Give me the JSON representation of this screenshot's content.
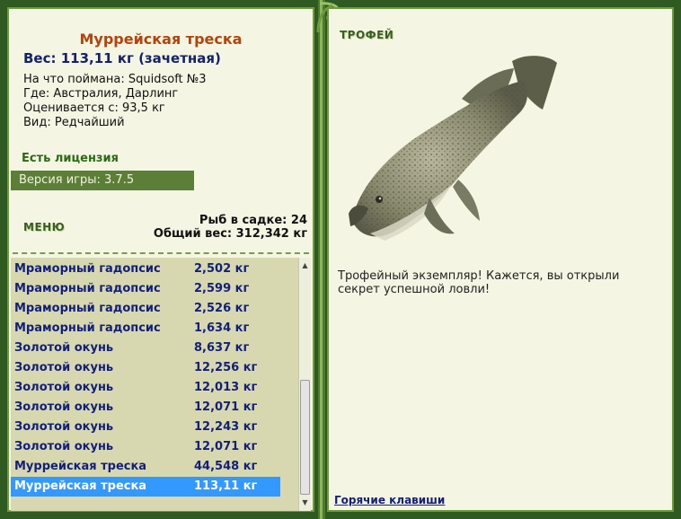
{
  "fish": {
    "title": "Муррейская треска",
    "weight": "Вес: 113,11 кг (зачетная)",
    "bait": "На что поймана: Squidsoft №3",
    "location": "Где: Австралия, Дарлинг",
    "scored_from": "Оценивается с: 93,5 кг",
    "rarity": "Вид: Редчайший"
  },
  "license": "Есть лицензия",
  "version": "Версия игры: 3.7.5",
  "menu_label": "МЕНЮ",
  "keepnet": {
    "count": "Рыб в садке: 24",
    "total": "Общий вес: 312,342 кг"
  },
  "catch_list": [
    {
      "name": "Мраморный гадопсис",
      "weight": "2,502 кг"
    },
    {
      "name": "Мраморный гадопсис",
      "weight": "2,599 кг"
    },
    {
      "name": "Мраморный гадопсис",
      "weight": "2,526 кг"
    },
    {
      "name": "Мраморный гадопсис",
      "weight": "1,634 кг"
    },
    {
      "name": "Золотой окунь",
      "weight": "8,637 кг"
    },
    {
      "name": "Золотой окунь",
      "weight": "12,256 кг"
    },
    {
      "name": "Золотой окунь",
      "weight": "12,013 кг"
    },
    {
      "name": "Золотой окунь",
      "weight": "12,071 кг"
    },
    {
      "name": "Золотой окунь",
      "weight": "12,243 кг"
    },
    {
      "name": "Золотой окунь",
      "weight": "12,071 кг"
    },
    {
      "name": "Муррейская треска",
      "weight": "44,548 кг"
    },
    {
      "name": "Муррейская треска",
      "weight": "113,11 кг"
    }
  ],
  "selected_index": 11,
  "scroll": {
    "up_icon": "arrow-up-icon",
    "down_icon": "arrow-down-icon"
  },
  "trophy": {
    "label": "ТРОФЕЙ",
    "text": "Трофейный экземпляр! Кажется, вы открыли секрет успешной ловли!"
  },
  "hotkeys": "Горячие клавиши",
  "colors": {
    "background": "#2f5a22",
    "panel": "#f5f5e3",
    "title": "#b3440c",
    "list_text": "#13207a",
    "selection": "#3399ff",
    "version_bar": "#5b7f36"
  }
}
